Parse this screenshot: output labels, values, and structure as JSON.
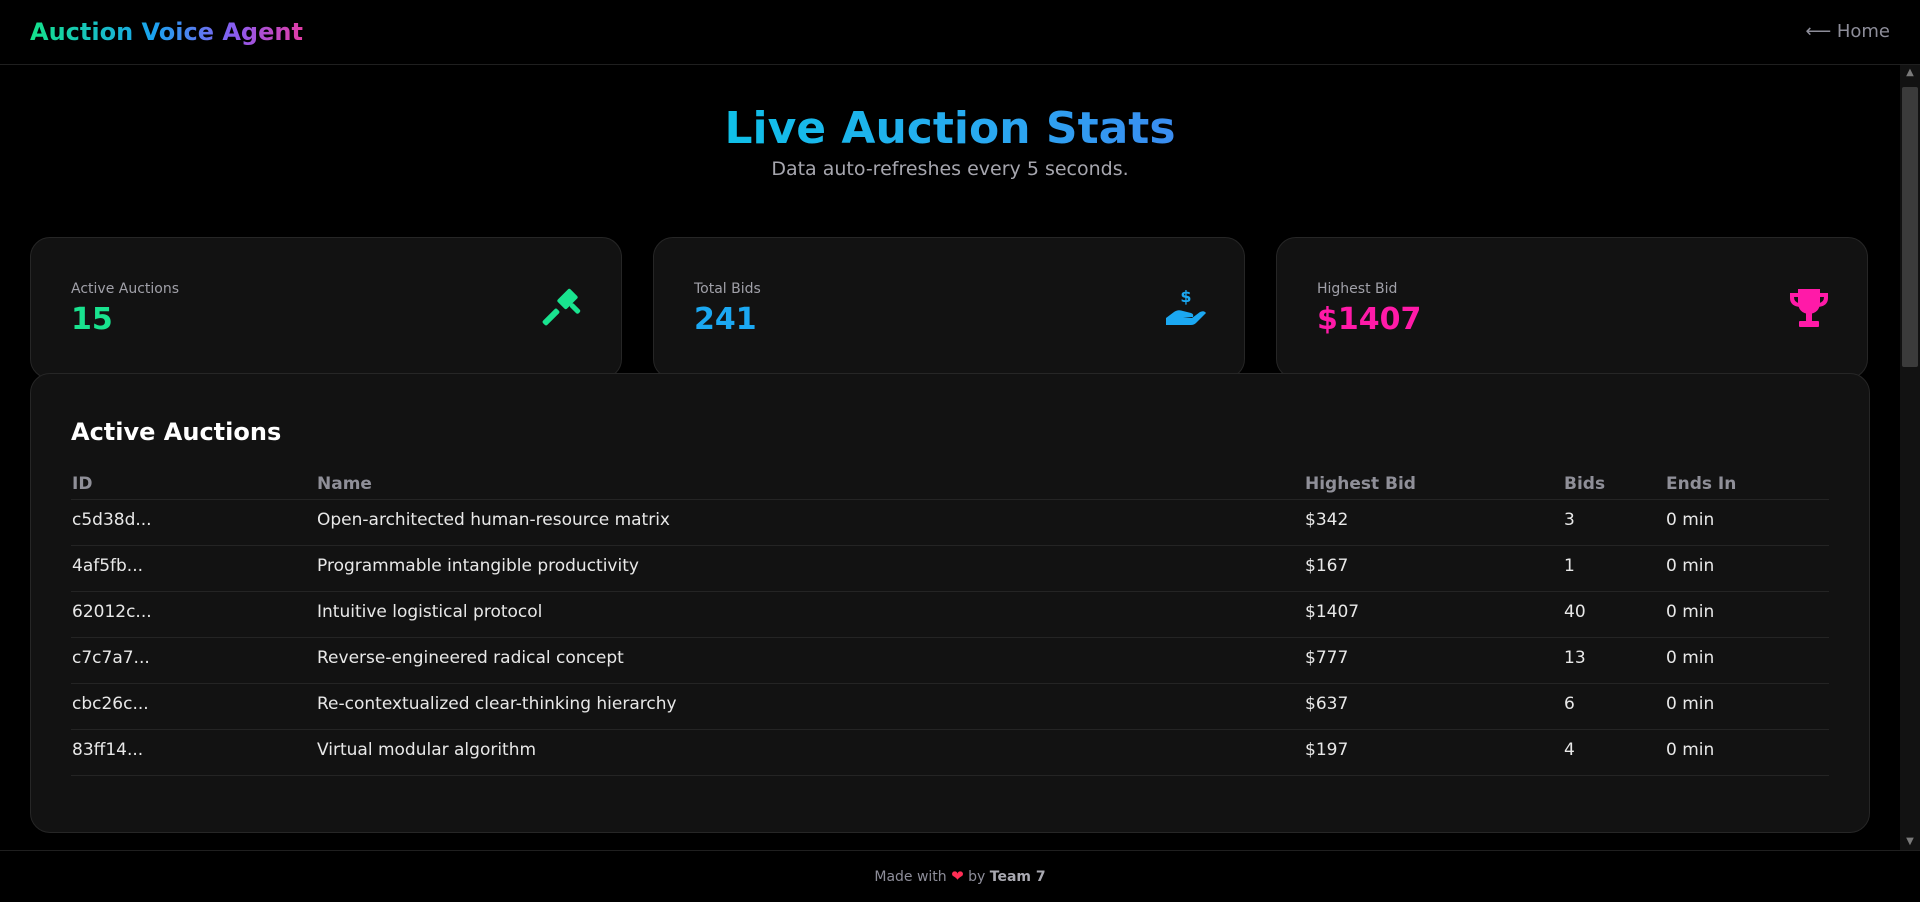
{
  "header": {
    "brand": "Auction Voice Agent",
    "home_link": "⟵ Home"
  },
  "page": {
    "title": "Live Auction Stats",
    "subtitle": "Data auto-refreshes every 5 seconds."
  },
  "stats": [
    {
      "label": "Active Auctions",
      "value": "15",
      "icon": "gavel-icon",
      "color": "#19e38f"
    },
    {
      "label": "Total Bids",
      "value": "241",
      "icon": "hand-dollar-icon",
      "color": "#1ba8f2"
    },
    {
      "label": "Highest Bid",
      "value": "$1407",
      "icon": "trophy-icon",
      "color": "#ff1aa8"
    }
  ],
  "auctions_table": {
    "title": "Active Auctions",
    "columns": [
      "ID",
      "Name",
      "Highest Bid",
      "Bids",
      "Ends In"
    ],
    "rows": [
      [
        "c5d38d...",
        "Open-architected human-resource matrix",
        "$342",
        "3",
        "0 min"
      ],
      [
        "4af5fb...",
        "Programmable intangible productivity",
        "$167",
        "1",
        "0 min"
      ],
      [
        "62012c...",
        "Intuitive logistical protocol",
        "$1407",
        "40",
        "0 min"
      ],
      [
        "c7c7a7...",
        "Reverse-engineered radical concept",
        "$777",
        "13",
        "0 min"
      ],
      [
        "cbc26c...",
        "Re-contextualized clear-thinking hierarchy",
        "$637",
        "6",
        "0 min"
      ],
      [
        "83ff14...",
        "Virtual modular algorithm",
        "$197",
        "4",
        "0 min"
      ]
    ]
  },
  "footer": {
    "made_with": "Made with",
    "heart": "❤",
    "by": "by",
    "team": "Team 7"
  }
}
